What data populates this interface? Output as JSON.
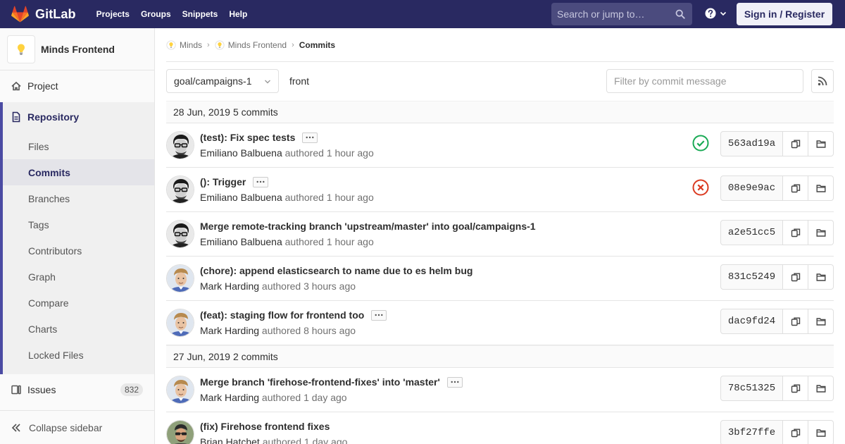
{
  "topnav": {
    "brand": "GitLab",
    "links": [
      "Projects",
      "Groups",
      "Snippets",
      "Help"
    ],
    "search_placeholder": "Search or jump to…",
    "signin_label": "Sign in / Register"
  },
  "sidebar": {
    "project_name": "Minds Frontend",
    "project_item": "Project",
    "repository": "Repository",
    "repo_items": [
      "Files",
      "Commits",
      "Branches",
      "Tags",
      "Contributors",
      "Graph",
      "Compare",
      "Charts",
      "Locked Files"
    ],
    "active_item": "Commits",
    "issues_label": "Issues",
    "issues_count": "832",
    "collapse_label": "Collapse sidebar"
  },
  "breadcrumb": {
    "group": "Minds",
    "project": "Minds Frontend",
    "current": "Commits"
  },
  "toolbar": {
    "branch": "goal/campaigns-1",
    "path": "front",
    "filter_placeholder": "Filter by commit message"
  },
  "days": [
    {
      "date": "28 Jun, 2019",
      "count": "5 commits",
      "commits": [
        {
          "title": "(test): Fix spec tests",
          "author": "Emiliano Balbuena",
          "authored": "authored",
          "time": "1 hour ago",
          "sha": "563ad19a",
          "has_more": true,
          "status": "success",
          "avatar": "a"
        },
        {
          "title": "(): Trigger",
          "author": "Emiliano Balbuena",
          "authored": "authored",
          "time": "1 hour ago",
          "sha": "08e9e9ac",
          "has_more": true,
          "status": "failed",
          "avatar": "a"
        },
        {
          "title": "Merge remote-tracking branch 'upstream/master' into goal/campaigns-1",
          "author": "Emiliano Balbuena",
          "authored": "authored",
          "time": "1 hour ago",
          "sha": "a2e51cc5",
          "has_more": false,
          "status": "",
          "avatar": "a"
        },
        {
          "title": "(chore): append elasticsearch to name due to es helm bug",
          "author": "Mark Harding",
          "authored": "authored",
          "time": "3 hours ago",
          "sha": "831c5249",
          "has_more": false,
          "status": "",
          "avatar": "b"
        },
        {
          "title": "(feat): staging flow for frontend too",
          "author": "Mark Harding",
          "authored": "authored",
          "time": "8 hours ago",
          "sha": "dac9fd24",
          "has_more": true,
          "status": "",
          "avatar": "b"
        }
      ]
    },
    {
      "date": "27 Jun, 2019",
      "count": "2 commits",
      "commits": [
        {
          "title": "Merge branch 'firehose-frontend-fixes' into 'master'",
          "author": "Mark Harding",
          "authored": "authored",
          "time": "1 day ago",
          "sha": "78c51325",
          "has_more": true,
          "status": "",
          "avatar": "b"
        },
        {
          "title": "(fix) Firehose frontend fixes",
          "author": "Brian Hatchet",
          "authored": "authored",
          "time": "1 day ago",
          "sha": "3bf27ffe",
          "has_more": false,
          "status": "",
          "avatar": "c"
        }
      ]
    }
  ],
  "colors": {
    "topnav": "#292961",
    "accent": "#4b4ba3",
    "success": "#1aaa55",
    "failed": "#db3b21"
  }
}
